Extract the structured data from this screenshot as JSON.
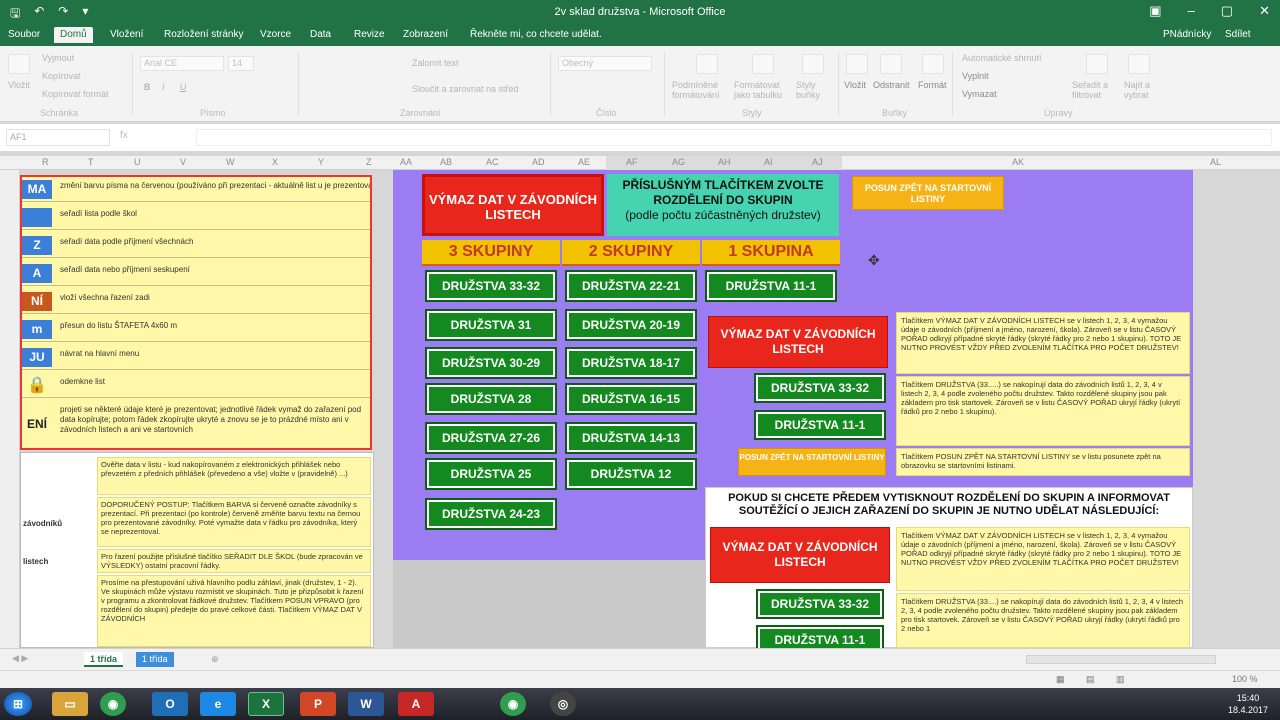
{
  "window": {
    "title": "2v sklad družstva - Microsoft Office",
    "qat_icons": [
      "save-icon",
      "undo-icon",
      "redo-icon",
      "customize-icon"
    ],
    "controls": [
      "▣",
      "–",
      "▢",
      "✕"
    ]
  },
  "ribbon_tabs": {
    "items": [
      "Soubor",
      "Domů",
      "Vložení",
      "Rozložení stránky",
      "Vzorce",
      "Data",
      "Revize",
      "Zobrazení"
    ],
    "active_index": 1,
    "tell_me": "Řekněte mi, co chcete udělat.",
    "user": "PNádnícky",
    "share": "Sdílet"
  },
  "ribbon": {
    "clipboard": {
      "paste": "Vložit",
      "cut": "Vyjmout",
      "copy": "Kopírovat",
      "format_painter": "Kopírovat formát",
      "label": "Schránka"
    },
    "font": {
      "name": "Arial CE",
      "size": "14",
      "bold": "B",
      "italic": "I",
      "underline": "U",
      "label": "Písmo"
    },
    "alignment": {
      "wrap": "Zalomit text",
      "merge": "Sloučit a zarovnat na střed",
      "label": "Zarovnání"
    },
    "number": {
      "format": "Obecný",
      "label": "Číslo"
    },
    "styles": {
      "conditional": "Podmíněné formátování",
      "table": "Formátovat jako tabulku",
      "cell_styles": "Styly buňky",
      "label": "Styly"
    },
    "cells": {
      "insert": "Vložit",
      "delete": "Odstranit",
      "format": "Formát",
      "label": "Buňky"
    },
    "editing": {
      "autosum": "Automatické shrnutí",
      "fill": "Vyplnit",
      "clear": "Vymazat",
      "sort": "Seřadit a filtrovat",
      "find": "Najít a vybrat",
      "label": "Úpravy"
    }
  },
  "formula_bar": {
    "name_box": "AF1",
    "fx": "fx",
    "value": ""
  },
  "columns": [
    "R",
    "T",
    "U",
    "V",
    "W",
    "X",
    "Y",
    "Z",
    "AA",
    "AB",
    "AC",
    "AD",
    "AE",
    "AF",
    "AG",
    "AH",
    "AI",
    "AJ",
    "AK",
    "AL"
  ],
  "left_panel": {
    "rows": [
      {
        "label": "MA",
        "color": "#3b7fd8",
        "text": "změní barvu písma na červenou (používáno při prezentaci - aktuálně list u je prezentování změní barvu na červeno)"
      },
      {
        "label": "",
        "color": "#3b7fd8",
        "text": "seřadí lista podle škol"
      },
      {
        "label": "Z",
        "color": "#3b7fd8",
        "text": "seřadí data podle příjmení všechnách"
      },
      {
        "label": "A",
        "color": "#3b7fd8",
        "text": "seřadí data nebo příjmení seskupení"
      },
      {
        "label": "NÍ",
        "color": "#c8571e",
        "text": "vloží všechna řazení zadi"
      },
      {
        "label": "m",
        "color": "#3b7fd8",
        "text": "přesun do listu ŠTAFETA 4x60 m"
      },
      {
        "label": "JU",
        "color": "#3b7fd8",
        "text": "návrat na hlavní menu"
      },
      {
        "label": "🔒",
        "color": "#fff8a8",
        "text": "odemkne list"
      },
      {
        "label": "ENÍ",
        "color": "#fff8a8",
        "text": "projeti se některé údaje které je prezentovat; jednotlivé řádek vymaž do zařazení pod data kopírujte; potom řádek zkopírujte ukryté a znovu se je to prázdné místo ani v závodních listech a ani ve startovních"
      }
    ]
  },
  "left_panel2": {
    "side1": "závodníků",
    "side2": "listech",
    "notes": [
      {
        "text": "Ověřte data v listu - kud nakopírovaném z elektronických přihlášek nebo převzetém z předních přihlášek (převedeno a vše) vložte v (pravidelně) ...)"
      },
      {
        "text": "DOPORUČENÝ POSTUP: Tlačítkem BARVA si červeně označte závodníky s prezentací. Při prezentaci (po kontrole) červeně změňte barvu textu na černou pro prezentované závodníky. Poté vymažte data v řádku pro závodníka, který se neprezentoval."
      },
      {
        "text": "Pro řazení použijte příslušné tlačítko SEŘADIT DLE ŠKOL (bude zpracován ve VÝSLEDKY) ostatní pracovní řádky."
      },
      {
        "text": "Prosíme na přestupování uživá hlavního podlu záhlaví, jinak (družstev, 1 - 2). Ve skupinách může výstavu rozmístit ve skupinách. Tuto je přizpůsobit k řazení v programu a zkontrolovat řádkové družstev. Tlačítkem POSUN VPRAVO (pro rozdělení do skupin) předejte do pravé celkové části. Tlačítkem VÝMAZ DAT V ZÁVODNÍCH"
      }
    ]
  },
  "main": {
    "clear_button": "VÝMAZ DAT V ZÁVODNÍCH LISTECH",
    "instruction": {
      "line1": "PŘÍSLUŠNÝM TLAČÍTKEM ZVOLTE",
      "line2": "ROZDĚLENÍ DO SKUPIN",
      "line3": "(podle počtu zúčastněných družstev)"
    },
    "back_button": "POSUN ZPĚT NA STARTOVNÍ LISTINY",
    "group_headers": [
      "3 SKUPINY",
      "2 SKUPINY",
      "1 SKUPINA"
    ],
    "col3": [
      "DRUŽSTVA 33-32",
      "DRUŽSTVA 31",
      "DRUŽSTVA 30-29",
      "DRUŽSTVA 28",
      "DRUŽSTVA 27-26",
      "DRUŽSTVA 25",
      "DRUŽSTVA 24-23"
    ],
    "col2": [
      "DRUŽSTVA 22-21",
      "DRUŽSTVA 20-19",
      "DRUŽSTVA 18-17",
      "DRUŽSTVA 16-15",
      "DRUŽSTVA 14-13",
      "DRUŽSTVA 12"
    ],
    "col1": [
      "DRUŽSTVA 11-1"
    ]
  },
  "legend": {
    "clear": "VÝMAZ DAT V ZÁVODNÍCH LISTECH",
    "btn_a": "DRUŽSTVA 33-32",
    "btn_b": "DRUŽSTVA 11-1",
    "back": "POSUN ZPĚT NA STARTOVNÍ LISTINY",
    "info1": "Tlačítkem VÝMAZ DAT V ZÁVODNÍCH LISTECH se v listech 1, 2, 3, 4 vymažou údaje o závodních (příjmení a jméno, narození, škola). Zároveň se v listu ČASOVÝ POŘAD odkryjí případné skryté řádky (skryté řádky pro 2 nebo 1 skupinu). TOTO JE NUTNO PROVÉST VŽDY PŘED ZVOLENÍM TLAČÍTKA PRO POČET DRUŽSTEV!",
    "info2": "Tlačítkem DRUŽSTVA (33.....) se nakopírují data do závodních listů 1, 2, 3, 4 v listech 2, 3, 4 podle zvoleného počtu družstev. Takto rozdělené skupiny jsou pak základem pro tisk startovek. Zároveň se v listu ČASOVÝ POŘAD ukryjí řádky (ukrytí řádků pro 2 nebo 1 skupinu).",
    "info3": "Tlačítkem POSUN ZPĚT NA STARTOVNÍ LISTINY se v listu posunete zpět na obrazovku se startovními listinami."
  },
  "bottom_box": {
    "title": "POKUD SI CHCETE PŘEDEM VYTISKNOUT ROZDĚLENÍ DO SKUPIN A INFORMOVAT SOUTĚŽÍCÍ O JEJICH ZAŘAZENÍ DO SKUPIN JE NUTNO UDĚLAT NÁSLEDUJÍCÍ:",
    "clear": "VÝMAZ DAT V ZÁVODNÍCH LISTECH",
    "btn_a": "DRUŽSTVA 33-32",
    "btn_b": "DRUŽSTVA 11-1",
    "info1": "Tlačítkem VÝMAZ DAT V ZÁVODNÍCH LISTECH se v listech 1, 2, 3, 4 vymažou údaje o závodních (příjmení a jméno, narození, škola). Zároveň se v listu ČASOVÝ POŘAD odkryjí případné skryté řádky (skryté řádky pro 2 nebo 1 skupinu). TOTO JE NUTNO PROVÉST VŽDY PŘED ZVOLENÍM TLAČÍTKA PRO POČET DRUŽSTEV!",
    "info2": "Tlačítkem DRUŽSTVA (33....) se nakopírují data do závodních listů 1, 2, 3, 4 v listech 2, 3, 4 podle zvoleného počtu družstev. Takto rozdělené skupiny jsou pak základem pro tisk startovek. Zároveň se v listu ČASOVÝ POŘAD ukryjí řádky (ukrytí řádků pro 2 nebo 1"
  },
  "sheets": {
    "tab1": "1 třída",
    "tab2": "1 třída",
    "add": "⊕"
  },
  "status": {
    "zoom": "100 %"
  },
  "taskbar": {
    "icons": [
      "windows-start-icon",
      "explorer-icon",
      "chrome-icon",
      "outlook-icon",
      "ie-icon",
      "excel-icon",
      "powerpoint-icon",
      "word-icon",
      "acrobat-icon",
      "chrome2-icon",
      "media-icon"
    ],
    "time": "15:40",
    "date": "18.4.2017"
  }
}
